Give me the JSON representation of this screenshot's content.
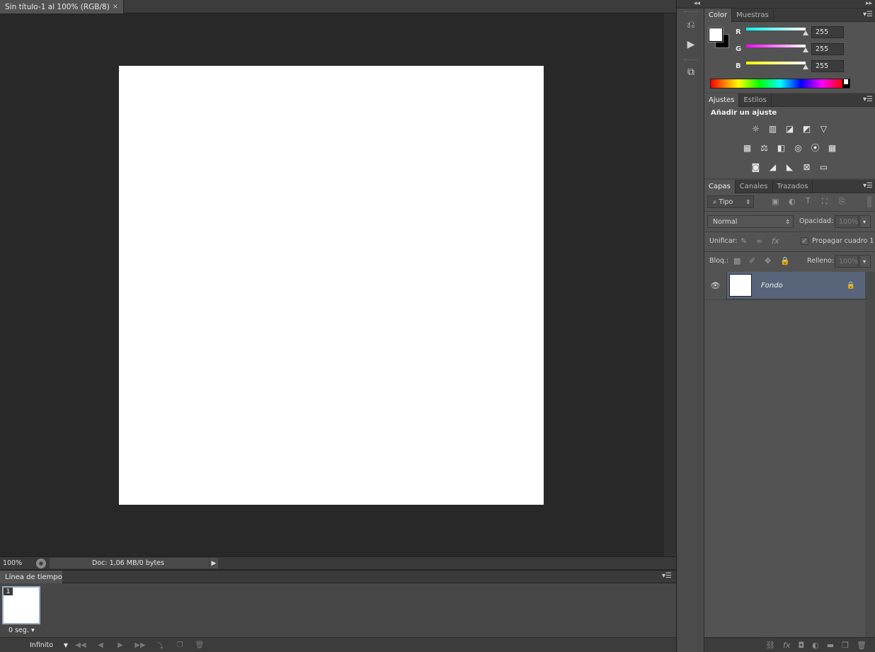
{
  "document": {
    "tab_title": "Sin título-1 al 100% (RGB/8)",
    "close_glyph": "×",
    "canvas_color": "#ffffff"
  },
  "status": {
    "zoom": "100%",
    "doc_info": "Doc: 1,06 MB/0 bytes"
  },
  "timeline": {
    "tab_label": "Línea de tiempo",
    "frame_number": "1",
    "frame_delay": "0 seg.",
    "loop_option": "Infinito"
  },
  "tool_strip": {
    "icons": [
      "history-icon",
      "play-actions-icon",
      "3d-cube-icon"
    ]
  },
  "color_panel": {
    "tabs": [
      "Color",
      "Muestras"
    ],
    "channels": [
      {
        "label": "R",
        "value": "255",
        "color": "#00e0e0"
      },
      {
        "label": "G",
        "value": "255",
        "color": "#e040e0"
      },
      {
        "label": "B",
        "value": "255",
        "color": "#e0e000"
      }
    ],
    "foreground": "#ffffff",
    "background": "#000000"
  },
  "adjustments_panel": {
    "tabs": [
      "Ajustes",
      "Estilos"
    ],
    "heading": "Añadir un ajuste"
  },
  "layers_panel": {
    "tabs": [
      "Capas",
      "Canales",
      "Trazados"
    ],
    "filter_kind": "Tipo",
    "blend_mode": "Normal",
    "opacity_label": "Opacidad:",
    "opacity_value": "100%",
    "unify_label": "Unificar:",
    "propagate_label": "Propagar cuadro 1",
    "lock_label": "Bloq.:",
    "fill_label": "Relleno:",
    "fill_value": "100%",
    "layers": [
      {
        "name": "Fondo",
        "visible": true,
        "locked": true
      }
    ]
  },
  "accent": "#58647a"
}
